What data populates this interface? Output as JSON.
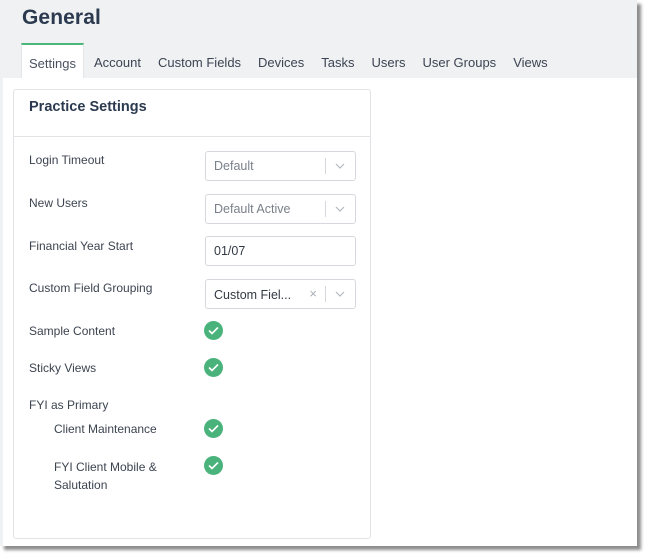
{
  "header": {
    "title": "General",
    "tabs": [
      {
        "label": "Settings",
        "active": true
      },
      {
        "label": "Account",
        "active": false
      },
      {
        "label": "Custom Fields",
        "active": false
      },
      {
        "label": "Devices",
        "active": false
      },
      {
        "label": "Tasks",
        "active": false
      },
      {
        "label": "Users",
        "active": false
      },
      {
        "label": "User Groups",
        "active": false
      },
      {
        "label": "Views",
        "active": false
      }
    ]
  },
  "panel": {
    "title": "Practice Settings",
    "login_timeout": {
      "label": "Login Timeout",
      "value": "Default",
      "icon": "chevron-down-icon"
    },
    "new_users": {
      "label": "New Users",
      "value": "Default Active",
      "icon": "chevron-down-icon"
    },
    "financial_year_start": {
      "label": "Financial Year Start",
      "value": "01/07"
    },
    "custom_field_grouping": {
      "label": "Custom Field Grouping",
      "value": "Custom Fiel...",
      "clear_icon": "×",
      "icon": "chevron-down-icon"
    },
    "sample_content": {
      "label": "Sample Content",
      "checked": true
    },
    "sticky_views": {
      "label": "Sticky Views",
      "checked": true
    },
    "fyi_as_primary": {
      "label": "FYI as Primary",
      "client_maintenance": {
        "label": "Client Maintenance",
        "checked": true
      },
      "fyi_client_mobile": {
        "label_line1": "FYI Client Mobile &",
        "label_line2": "Salutation",
        "checked": true
      }
    }
  },
  "colors": {
    "accent": "#4cb57a",
    "check": "#4ab37b",
    "title": "#2b3a4e",
    "header_bg": "#f0f1f3"
  }
}
